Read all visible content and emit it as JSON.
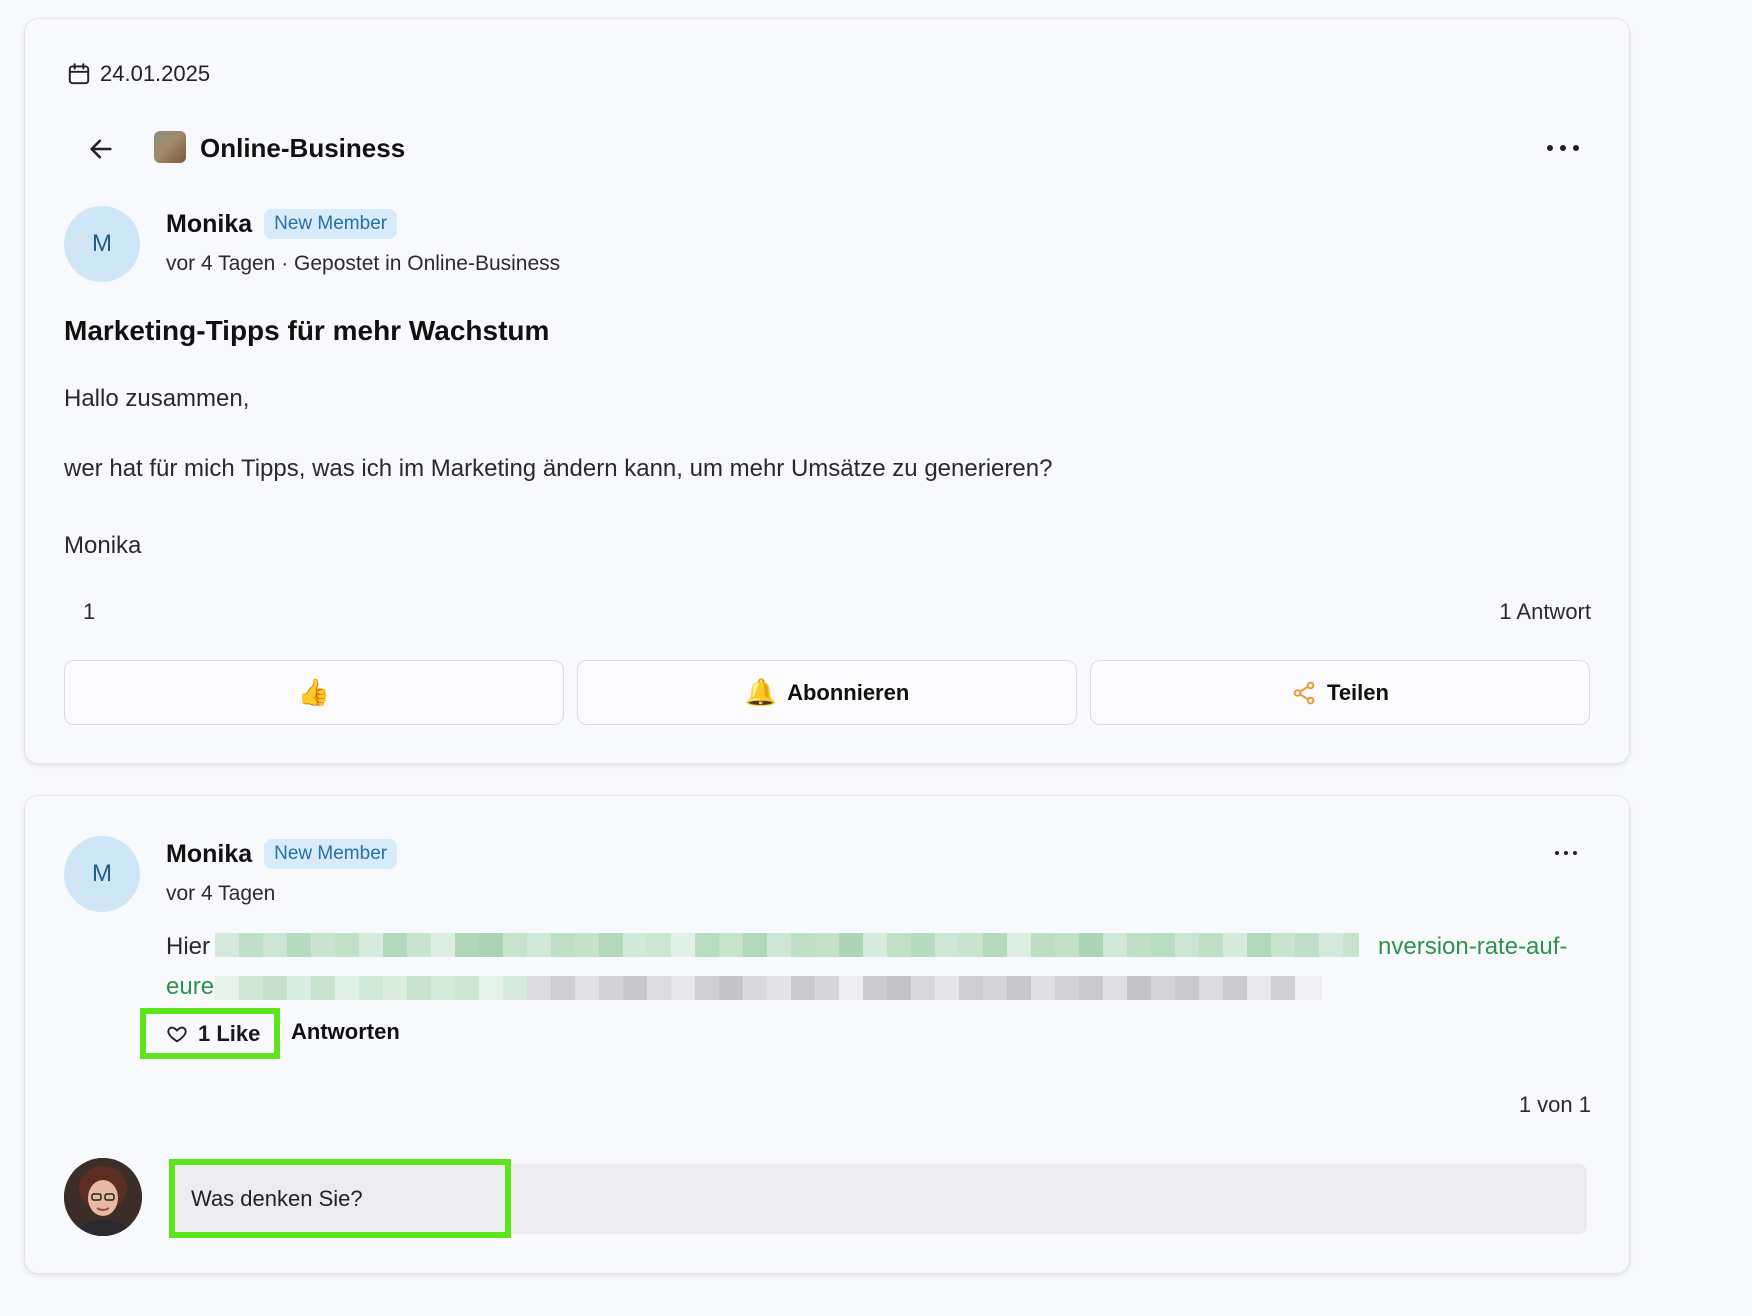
{
  "post": {
    "date": "24.01.2025",
    "group_name": "Online-Business",
    "author": {
      "initial": "M",
      "name": "Monika",
      "badge": "New Member",
      "meta": "vor 4 Tagen · Gepostet in Online-Business"
    },
    "title": "Marketing-Tipps für mehr Wachstum",
    "greeting": "Hallo zusammen,",
    "body": "wer hat für mich Tipps, was ich im Marketing ändern kann, um mehr Umsätze zu generieren?",
    "signature": "Monika",
    "reaction_count": "1",
    "reply_count": "1 Antwort",
    "actions": {
      "like_emoji": "👍",
      "subscribe_label": "Abonnieren",
      "share_label": "Teilen"
    }
  },
  "reply": {
    "author": {
      "initial": "M",
      "name": "Monika",
      "badge": "New Member",
      "meta": "vor 4 Tagen"
    },
    "text_start": "Hier",
    "link_end_line1": "nversion-rate-auf-",
    "link_start_line2": "eure",
    "like_label": "1 Like",
    "reply_label": "Antworten",
    "pagination": "1 von 1",
    "comment_placeholder": "Was denken Sie?"
  },
  "colors": {
    "highlight": "#5ee41c",
    "link": "#2f9150",
    "badge_bg": "#d7ebfb",
    "badge_text": "#2770a8",
    "avatar_bg": "#cfe6f7",
    "share_icon": "#f0962e"
  }
}
